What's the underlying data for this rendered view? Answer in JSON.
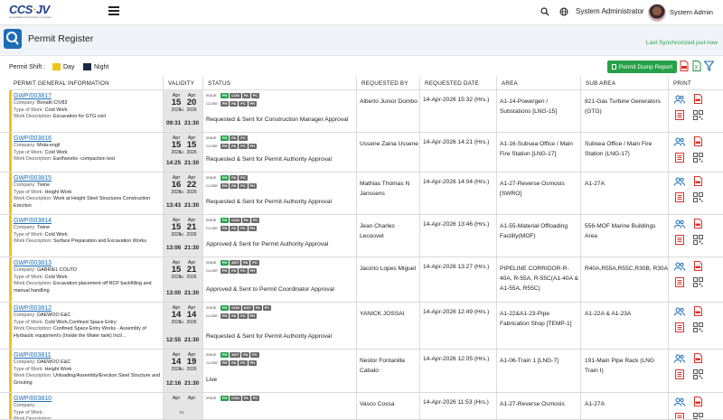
{
  "header": {
    "logo_text": "CCS",
    "logo_text2": "JV",
    "logo_sub": "Consolidated Contractors Company",
    "role": "System Administrator",
    "user": "System Admin"
  },
  "page": {
    "title": "Permit Register",
    "sync": "Last Synchronized just now"
  },
  "shift": {
    "label": "Permit Shift :",
    "day": "Day",
    "night": "Night"
  },
  "toolbar": {
    "dump_label": "Permit Dump Report"
  },
  "columns": [
    "PERMIT GENERAL INFORMATION",
    "VALIDITY",
    "STATUS",
    "REQUESTED BY",
    "REQUESTED DATE",
    "AREA",
    "SUB AREA",
    "PRINT"
  ],
  "labels": {
    "company": "Company:",
    "type": "Type of Work:",
    "desc": "Work Description:",
    "to": "TO",
    "issue": "ISSUE",
    "close": "CLOSE"
  },
  "rows": [
    {
      "id": "GWP/003817",
      "company": "Bonatti CIV83",
      "type": "Cold Work",
      "desc": "Excavation for GTG civil",
      "from_m": "Apr",
      "from_d": "15",
      "from_y": "2026",
      "to_m": "Apr",
      "to_d": "20",
      "to_y": "2026",
      "t1": "09:31",
      "t2": "21:30",
      "issue": [
        "PH",
        "CON",
        "PA",
        "PC"
      ],
      "close": [
        "PH",
        "PA",
        "PC",
        "PH"
      ],
      "status": "Requested & Sent for Construction Manager Approval",
      "req": "Alberto Junior Dombo",
      "date": "14-Apr-2026 15:32 (Hrs.)",
      "area": "A1-14-Powergen / Substations [LNG-15]",
      "sub": "821-Gas Turbine Generators (GTG)"
    },
    {
      "id": "GWP/003816",
      "company": "Mota-engil",
      "type": "Cold Work",
      "desc": "Earthworks -compaction test",
      "from_m": "Apr",
      "from_d": "15",
      "from_y": "2026",
      "to_m": "Apr",
      "to_d": "15",
      "to_y": "2026",
      "t1": "14:25",
      "t2": "21:30",
      "issue": [
        "PH",
        "PA",
        "PC"
      ],
      "close": [
        "PH",
        "PA",
        "PC",
        "PH"
      ],
      "status": "Requested & Sent for Permit Authority Approval",
      "req": "Ussene Zaina Ussene",
      "date": "14-Apr-2026 14:21 (Hrs.)",
      "area": "A1-16-Subsea Office / Main Fire Station [LNG-17]",
      "sub": "Subsea Office / Main Fire Station (LNG-17)"
    },
    {
      "id": "GWP/003815",
      "company": "Twine",
      "type": "Height Work",
      "desc": "Work at Height Steel Structures Construction Erection",
      "from_m": "Apr",
      "from_d": "16",
      "from_y": "2026",
      "to_m": "Apr",
      "to_d": "22",
      "to_y": "2026",
      "t1": "13:43",
      "t2": "21:30",
      "issue": [
        "PH",
        "PA",
        "PC"
      ],
      "close": [
        "PH",
        "PA",
        "PC",
        "PH"
      ],
      "status": "Requested & Sent for Permit Authority Approval",
      "req": "Mathias Thomas N Janssens",
      "date": "14-Apr-2026 14:04 (Hrs.)",
      "area": "A1-27-Reverse Osmosis [SWRO]",
      "sub": "A1-27A"
    },
    {
      "id": "GWP/003814",
      "company": "Twine",
      "type": "Cold Work",
      "desc": "Surface Preparation and Excavation Works",
      "from_m": "Apr",
      "from_d": "15",
      "from_y": "2026",
      "to_m": "Apr",
      "to_d": "21",
      "to_y": "2026",
      "t1": "13:06",
      "t2": "21:30",
      "issue": [
        "PH",
        "CON",
        "PA",
        "PC"
      ],
      "close": [
        "PH",
        "PA",
        "PC",
        "PH"
      ],
      "status": "Approved & Sent for Permit Authority Approval",
      "req": "Jean Charles Lecouvet",
      "date": "14-Apr-2026 13:46 (Hrs.)",
      "area": "A1-55-Material Offloading Facility(MOF)",
      "sub": "556-MOF Marine Buildings Area"
    },
    {
      "id": "GWP/003813",
      "company": "GABRIEL COUTO",
      "type": "Cold Work",
      "desc": "Excavation placement off RCP backfilling and manual handling",
      "from_m": "Apr",
      "from_d": "15",
      "from_y": "2026",
      "to_m": "Apr",
      "to_d": "21",
      "to_y": "2026",
      "t1": "13:00",
      "t2": "21:30",
      "issue": [
        "PH",
        "AGT",
        "PA",
        "PC"
      ],
      "close": [
        "PH",
        "PA",
        "PC",
        "PH"
      ],
      "status": "Approved & Sent to Permit Coordinator Approval",
      "req": "Jacinto Lopes Miguel",
      "date": "14-Apr-2026 13:27 (Hrs.)",
      "area": "PIPELINE CORRIDOR-R-40A, R-55A, R-55C(A1-40A & A1-55A, R55C)",
      "sub": "R40A,R55A,R55C,R30B, R30A"
    },
    {
      "id": "GWP/003812",
      "company": "DAEWOO E&C",
      "type": "Cold Work,Confined Space Entry",
      "desc": "Confined Space Entry Works - Assembly of Hydraulic equipment's (Inside the Water tank) Incl/...",
      "from_m": "Apr",
      "from_d": "14",
      "from_y": "2026",
      "to_m": "Apr",
      "to_d": "14",
      "to_y": "2026",
      "t1": "12:55",
      "t2": "21:30",
      "issue": [
        "PH",
        "CON",
        "AGT",
        "PA",
        "PC"
      ],
      "close": [
        "PH",
        "PA",
        "PC",
        "PH"
      ],
      "status": "Requested & Sent for Permit Authority Approval",
      "req": "YANICK JOSSAI",
      "date": "14-Apr-2026 12:49 (Hrs.)",
      "area": "A1-22&A1-23-Pipe Fabrication Shop [TEMP-1]",
      "sub": "A1-22A & A1-23A"
    },
    {
      "id": "GWP/003811",
      "company": "DAEWOO E&C",
      "type": "Height Work",
      "desc": "Unloading/Assembly/Erection Steel Structure and Grouting",
      "from_m": "Apr",
      "from_d": "14",
      "from_y": "2026",
      "to_m": "Apr",
      "to_d": "19",
      "to_y": "2026",
      "t1": "12:16",
      "t2": "21:30",
      "issue": [
        "PH",
        "AGT",
        "PA",
        "PC"
      ],
      "close": [
        "PH",
        "PA",
        "PC",
        "PH"
      ],
      "status": "Live",
      "req": "Nestor Fontanilla Cabalo",
      "date": "14-Apr-2026 12:05 (Hrs.)",
      "area": "A1-06-Train 1 [LNG-7]",
      "sub": "191-Main Pipe Rack (LNG Train I)"
    },
    {
      "id": "GWP/003810",
      "company": "",
      "type": "",
      "desc": "",
      "from_m": "Apr",
      "from_d": "",
      "from_y": "",
      "to_m": "Apr",
      "to_d": "",
      "to_y": "",
      "t1": "",
      "t2": "",
      "issue": [
        "PH",
        "CON",
        "PA",
        "PC"
      ],
      "close": [],
      "status": "",
      "req": "Vasco Cossa",
      "date": "14-Apr-2026 11:53 (Hrs.)",
      "area": "A1-27-Reverse Osmosis",
      "sub": "A1-27A"
    }
  ]
}
